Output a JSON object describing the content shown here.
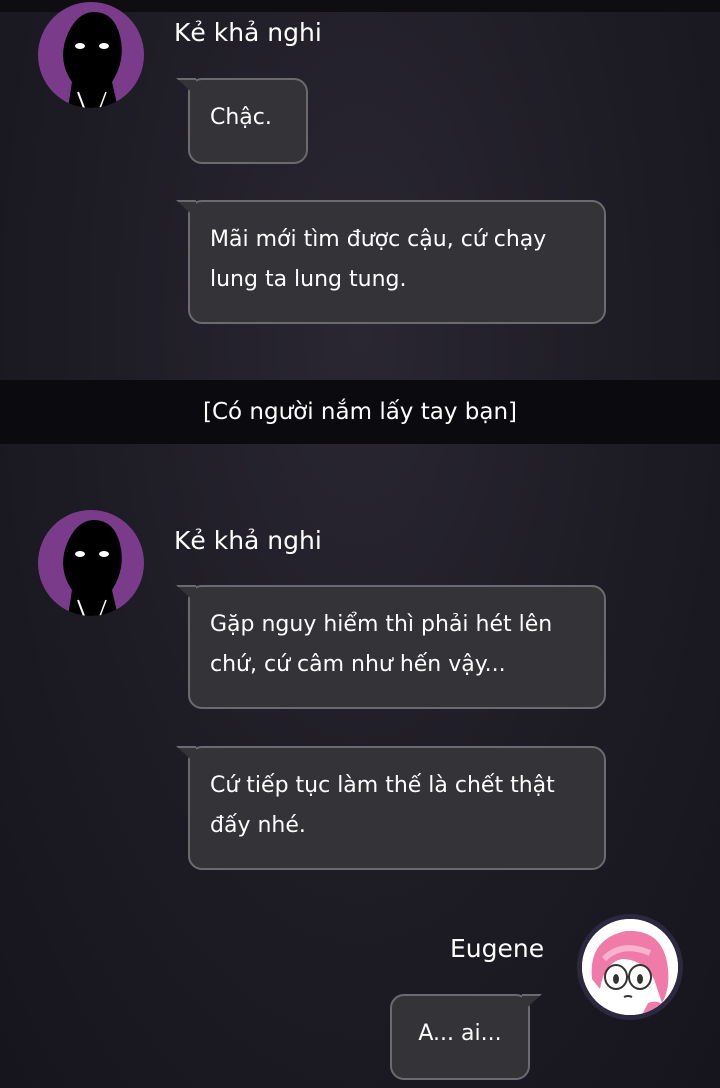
{
  "messages_group_1": {
    "sender_name": "Kẻ khả nghi",
    "avatar_icon": "shadow-figure-icon",
    "bubbles": [
      {
        "text": "Chậc."
      },
      {
        "text": "Mãi mới tìm được cậu, cứ chạy lung ta lung tung."
      }
    ]
  },
  "system_event": {
    "text": "[Có người nắm lấy tay bạn]"
  },
  "messages_group_2": {
    "sender_name": "Kẻ khả nghi",
    "avatar_icon": "shadow-figure-icon",
    "bubbles": [
      {
        "text": "Gặp nguy hiểm thì phải hét lên chứ, cứ câm như hến vậy..."
      },
      {
        "text": "Cứ tiếp tục làm thế là chết thật đấy nhé."
      }
    ]
  },
  "messages_group_3": {
    "sender_name": "Eugene",
    "avatar_icon": "eugene-portrait-icon",
    "bubbles": [
      {
        "text": "A... ai..."
      }
    ]
  },
  "colors": {
    "background": "#1d1b24",
    "bubble_fill": "#333338",
    "bubble_border": "#6a6a70",
    "suspect_avatar_bg": "#7a3c8a",
    "banner_bg": "#0b0a0e",
    "eugene_hair": "#f07aa8"
  }
}
